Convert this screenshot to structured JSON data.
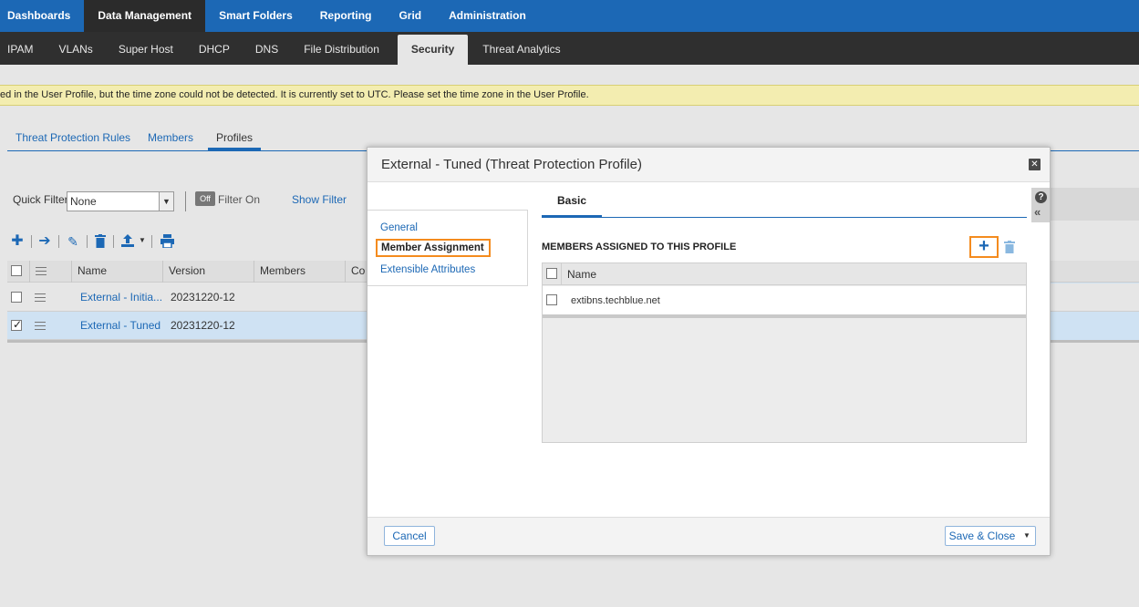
{
  "top_nav": [
    "Dashboards",
    "Data Management",
    "Smart Folders",
    "Reporting",
    "Grid",
    "Administration"
  ],
  "sub_nav": [
    "IPAM",
    "VLANs",
    "Super Host",
    "DHCP",
    "DNS",
    "File Distribution",
    "Security",
    "Threat Analytics"
  ],
  "warning": "ed in the User Profile, but the time zone could not be detected. It is currently set to UTC. Please set the time zone in the User Profile.",
  "page_tabs": [
    "Threat Protection Rules",
    "Members",
    "Profiles"
  ],
  "filter": {
    "label": "Quick Filter",
    "value": "None",
    "toggle": "Off",
    "toggle_label": "Filter On",
    "show_filter": "Show Filter"
  },
  "grid": {
    "columns": [
      "Name",
      "Version",
      "Members",
      "Co"
    ],
    "rows": [
      {
        "name": "External - Initia...",
        "version": "20231220-12",
        "checked": false
      },
      {
        "name": "External - Tuned",
        "version": "20231220-12",
        "checked": true
      }
    ]
  },
  "dialog": {
    "title": "External - Tuned (Threat Protection Profile)",
    "nav": [
      "General",
      "Member Assignment",
      "Extensible Attributes"
    ],
    "tab": "Basic",
    "section_title": "MEMBERS ASSIGNED TO THIS PROFILE",
    "table_header": "Name",
    "members": [
      "extibns.techblue.net"
    ],
    "cancel": "Cancel",
    "save": "Save & Close"
  },
  "colors": {
    "brand_blue": "#1c68b5",
    "highlight_orange": "#f48b1e",
    "warning_bg": "#f3edb0"
  }
}
